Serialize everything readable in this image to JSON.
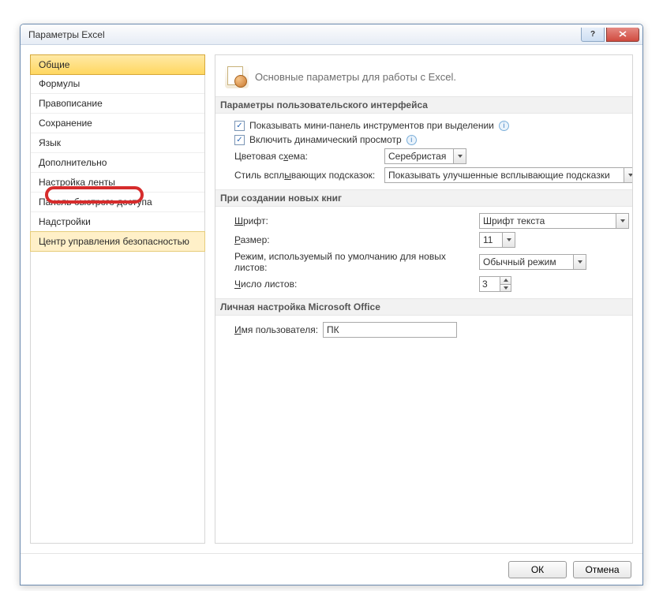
{
  "window": {
    "title": "Параметры Excel"
  },
  "nav": {
    "items": [
      "Общие",
      "Формулы",
      "Правописание",
      "Сохранение",
      "Язык",
      "Дополнительно",
      "Настройка ленты",
      "Панель быстрого доступа",
      "Надстройки",
      "Центр управления безопасностью"
    ]
  },
  "header": {
    "subtitle": "Основные параметры для работы с Excel."
  },
  "section_ui": {
    "title": "Параметры пользовательского интерфейса",
    "chk_minipanel": "Показывать мини-панель инструментов при выделении",
    "chk_livepreview": "Включить динамический просмотр",
    "color_label_pre": "Цветовая с",
    "color_label_u": "х",
    "color_label_post": "ема:",
    "color_value": "Серебристая",
    "tooltip_label_pre": "Стиль вспл",
    "tooltip_label_u": "ы",
    "tooltip_label_post": "вающих подсказок:",
    "tooltip_value": "Показывать улучшенные всплывающие подсказки"
  },
  "section_newbook": {
    "title": "При создании новых книг",
    "font_label_u": "Ш",
    "font_label_post": "рифт:",
    "font_value": "Шрифт текста",
    "size_label_pre": "",
    "size_label_u": "Р",
    "size_label_post": "азмер:",
    "size_value": "11",
    "mode_label": "Режим, используемый по умолчанию для новых листов:",
    "mode_value": "Обычный режим",
    "sheets_label_u": "Ч",
    "sheets_label_post": "исло листов:",
    "sheets_value": "3"
  },
  "section_personal": {
    "title": "Личная настройка Microsoft Office",
    "user_label_u": "И",
    "user_label_post": "мя пользователя:",
    "user_value": "ПК"
  },
  "footer": {
    "ok": "ОК",
    "cancel": "Отмена"
  }
}
